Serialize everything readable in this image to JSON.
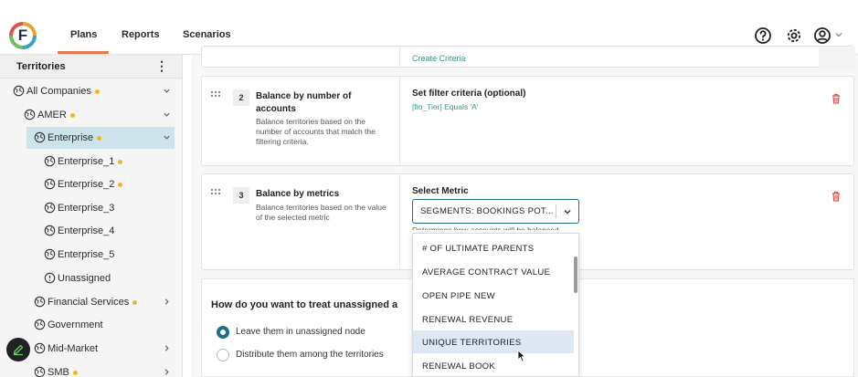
{
  "nav": {
    "logo_letter": "F",
    "items": [
      "Plans",
      "Reports",
      "Scenarios"
    ],
    "active": "Plans"
  },
  "sidebar": {
    "title": "Territories",
    "items": [
      {
        "label": "All Companies",
        "dot": true
      },
      {
        "label": "AMER",
        "dot": true
      },
      {
        "label": "Enterprise",
        "dot": true
      },
      {
        "label": "Enterprise_1",
        "dot": true
      },
      {
        "label": "Enterprise_2",
        "dot": true
      },
      {
        "label": "Enterprise_3",
        "dot": false
      },
      {
        "label": "Enterprise_4",
        "dot": false
      },
      {
        "label": "Enterprise_5",
        "dot": false
      },
      {
        "label": "Unassigned",
        "dot": false
      },
      {
        "label": "Financial Services",
        "dot": true
      },
      {
        "label": "Government",
        "dot": false
      },
      {
        "label": "Mid-Market",
        "dot": false
      },
      {
        "label": "SMB",
        "dot": true
      }
    ]
  },
  "main": {
    "prev_card_link": "Create Criteria",
    "card2": {
      "step": "2",
      "title": "Balance by number of accounts",
      "desc": "Balance territories based on the number of accounts that match the filtering criteria.",
      "right_title": "Set filter criteria (optional)",
      "right_sub": "[fio_Tier] Equals 'A'"
    },
    "card3": {
      "step": "3",
      "title": "Balance by metrics",
      "desc": "Balance territories based on the value of the selected metric",
      "right_title": "Select Metric",
      "selected_metric": "SEGMENTS: BOOKINGS POT...",
      "hint": "Determines how accounts will be balanced"
    },
    "unassigned": {
      "question": "How do you want to treat unassigned a",
      "options": [
        "Leave them in unassigned node",
        "Distribute them among the territories"
      ],
      "selected": 0
    },
    "dropdown": {
      "options": [
        "# OF ULTIMATE PARENTS",
        "AVERAGE CONTRACT VALUE",
        "OPEN PIPE NEW",
        "RENEWAL REVENUE",
        "UNIQUE TERRITORIES",
        "RENEWAL BOOK"
      ],
      "hovered": 4
    }
  },
  "colors": {
    "accent": "#1e6f8a",
    "nav_underline": "#e8764a",
    "dot": "#f1b72a",
    "selected_bg": "#cce3ea",
    "link_green": "#3a9a6e",
    "trash_red": "#d9534f"
  }
}
